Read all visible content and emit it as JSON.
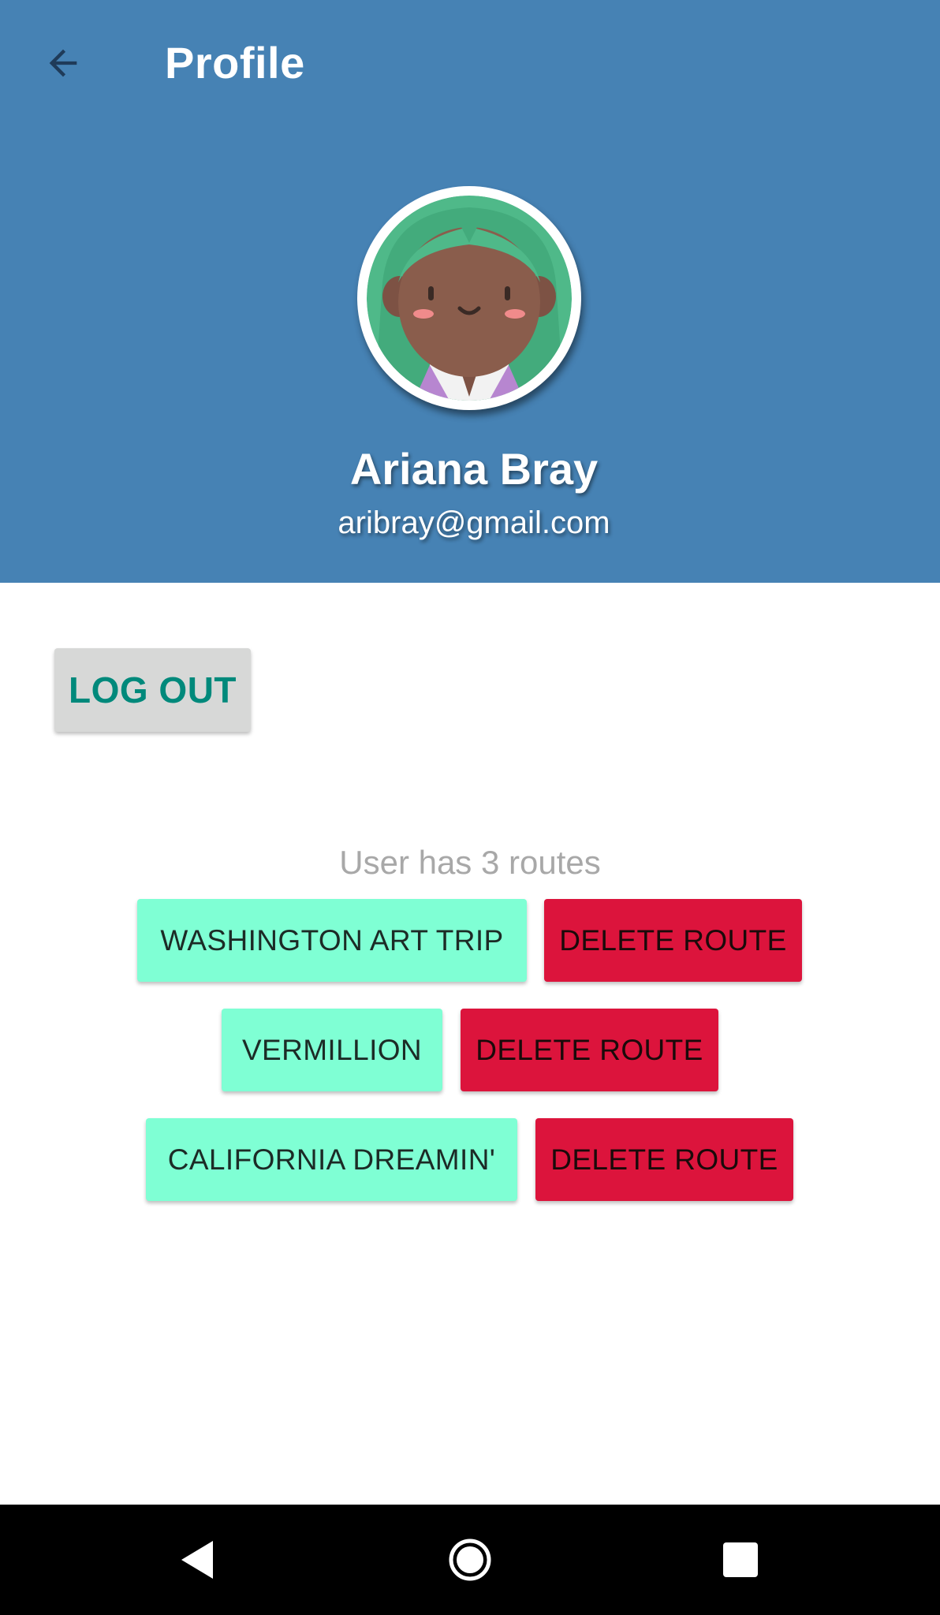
{
  "header": {
    "title": "Profile",
    "back_icon": "arrow-back-icon",
    "background_color": "#4682b4"
  },
  "profile": {
    "name": "Ariana Bray",
    "email": "aribray@gmail.com",
    "avatar_icon": "girl-avatar-icon"
  },
  "actions": {
    "logout_label": "LOG OUT"
  },
  "routes": {
    "summary": "User has 3 routes",
    "items": [
      {
        "name": "WASHINGTON ART TRIP",
        "delete_label": "DELETE ROUTE"
      },
      {
        "name": "VERMILLION",
        "delete_label": "DELETE ROUTE"
      },
      {
        "name": "CALIFORNIA DREAMIN'",
        "delete_label": "DELETE ROUTE"
      }
    ],
    "route_color": "#7fffd4",
    "delete_color": "#dc143c"
  },
  "system_nav": {
    "back_icon": "nav-back-icon",
    "home_icon": "nav-home-icon",
    "recents_icon": "nav-recents-icon"
  }
}
